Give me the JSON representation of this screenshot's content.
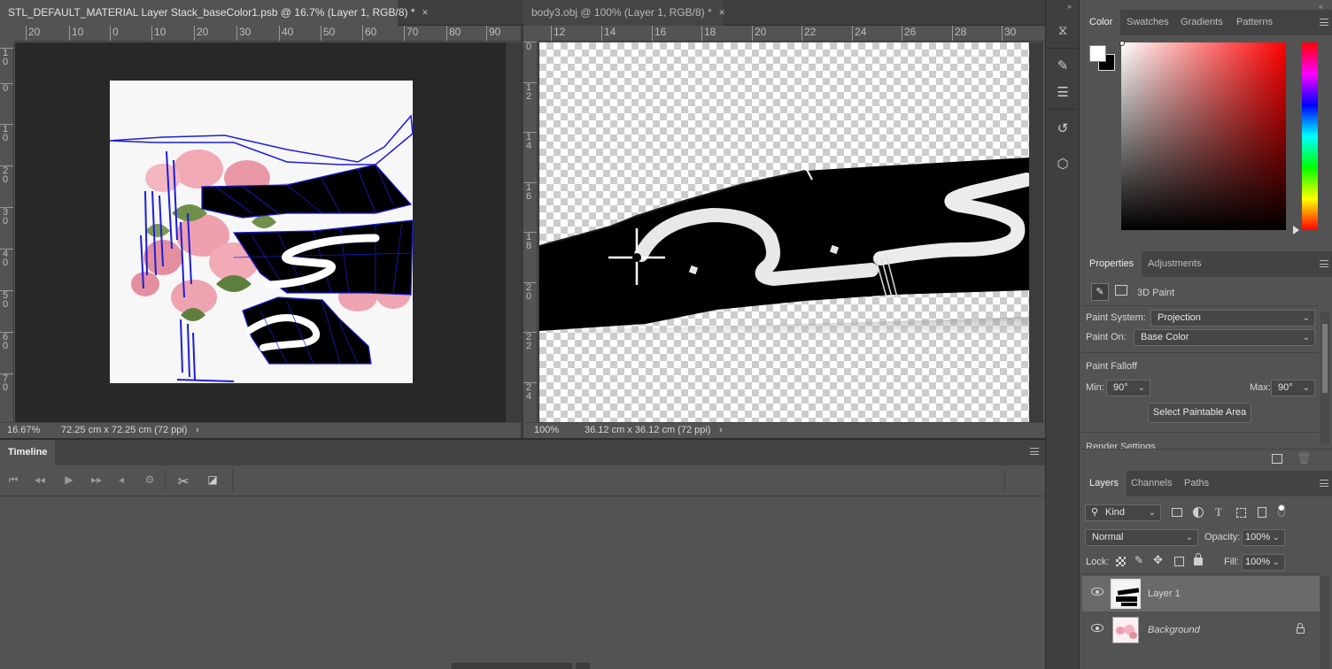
{
  "doc_tabs": [
    {
      "title": "STL_DEFAULT_MATERIAL Layer Stack_baseColor1.psb @ 16.7% (Layer 1, RGB/8) *",
      "close": "×"
    },
    {
      "title": "body3.obj @ 100% (Layer 1, RGB/8) *",
      "close": "×"
    }
  ],
  "left_doc": {
    "ruler_h": [
      "20",
      "10",
      "0",
      "10",
      "20",
      "30",
      "40",
      "50",
      "60",
      "70",
      "80",
      "90"
    ],
    "ruler_v": [
      "1\n0",
      "0",
      "1\n0",
      "2\n0",
      "3\n0",
      "4\n0",
      "5\n0",
      "6\n0",
      "7\n0"
    ],
    "zoom": "16.67%",
    "size": "72.25 cm x 72.25 cm (72 ppi)",
    "arrow": "›"
  },
  "right_doc": {
    "ruler_h": [
      "12",
      "14",
      "16",
      "18",
      "20",
      "22",
      "24",
      "26",
      "28",
      "30"
    ],
    "ruler_v": [
      "0",
      "1\n2",
      "1\n4",
      "1\n6",
      "1\n8",
      "2\n0",
      "2\n2",
      "2\n4"
    ],
    "zoom": "100%",
    "size": "36.12 cm x 36.12 cm (72 ppi)",
    "arrow": "›"
  },
  "timeline": {
    "title": "Timeline"
  },
  "color_panel": {
    "tabs": [
      "Color",
      "Swatches",
      "Gradients",
      "Patterns"
    ],
    "foreground": "#ffffff",
    "background": "#000000",
    "hue_color": "#ff0000"
  },
  "properties_panel": {
    "tabs": [
      "Properties",
      "Adjustments"
    ],
    "mode_label": "3D Paint",
    "paint_system_label": "Paint System:",
    "paint_system_value": "Projection",
    "paint_on_label": "Paint On:",
    "paint_on_value": "Base Color",
    "falloff_label": "Paint Falloff",
    "min_label": "Min:",
    "min_value": "90°",
    "max_label": "Max:",
    "max_value": "90°",
    "select_button": "Select Paintable Area",
    "render_settings": "Render Settings"
  },
  "layers_panel": {
    "tabs": [
      "Layers",
      "Channels",
      "Paths"
    ],
    "filter": "Kind",
    "blend_mode": "Normal",
    "opacity_label": "Opacity:",
    "opacity_value": "100%",
    "lock_label": "Lock:",
    "fill_label": "Fill:",
    "fill_value": "100%",
    "layers": [
      {
        "name": "Layer 1",
        "selected": true
      },
      {
        "name": "Background",
        "locked": true
      }
    ]
  },
  "colors": {
    "panel": "#535353",
    "panel_dark": "#434343",
    "canvas_bg": "#282828",
    "selected_row": "#6a6a6a",
    "uv_wire": "#1d1dd8"
  }
}
